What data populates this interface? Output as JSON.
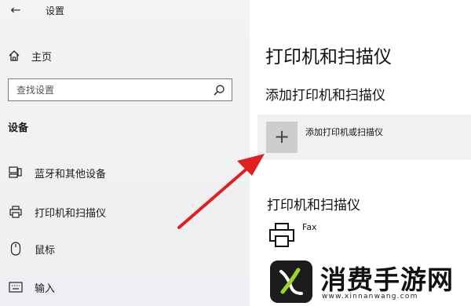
{
  "window": {
    "title": "设置"
  },
  "sidebar": {
    "home_label": "主页",
    "search": {
      "placeholder": "查找设置",
      "value": ""
    },
    "section_label": "设备",
    "items": [
      {
        "label": "蓝牙和其他设备",
        "icon": "bluetooth-devices-icon"
      },
      {
        "label": "打印机和扫描仪",
        "icon": "printer-icon"
      },
      {
        "label": "鼠标",
        "icon": "mouse-icon"
      },
      {
        "label": "输入",
        "icon": "keyboard-icon"
      }
    ]
  },
  "main": {
    "title": "打印机和扫描仪",
    "add_section_title": "添加打印机和扫描仪",
    "add_button_label": "添加打印机或扫描仪",
    "list_section_title": "打印机和扫描仪",
    "devices": [
      {
        "name": "Fax",
        "icon": "fax-printer-icon"
      },
      {
        "name": "",
        "icon": "printer-icon"
      }
    ]
  },
  "annotation": {
    "arrow_color": "#e02020"
  },
  "watermark": {
    "text": "消费手游网",
    "url": "www.xinnanwang.com"
  },
  "colors": {
    "sidebar_bg": "#f3f3f3",
    "content_bg": "#ffffff",
    "add_tile": "#cdcdcd",
    "add_button_bg": "#f1f1f1"
  }
}
